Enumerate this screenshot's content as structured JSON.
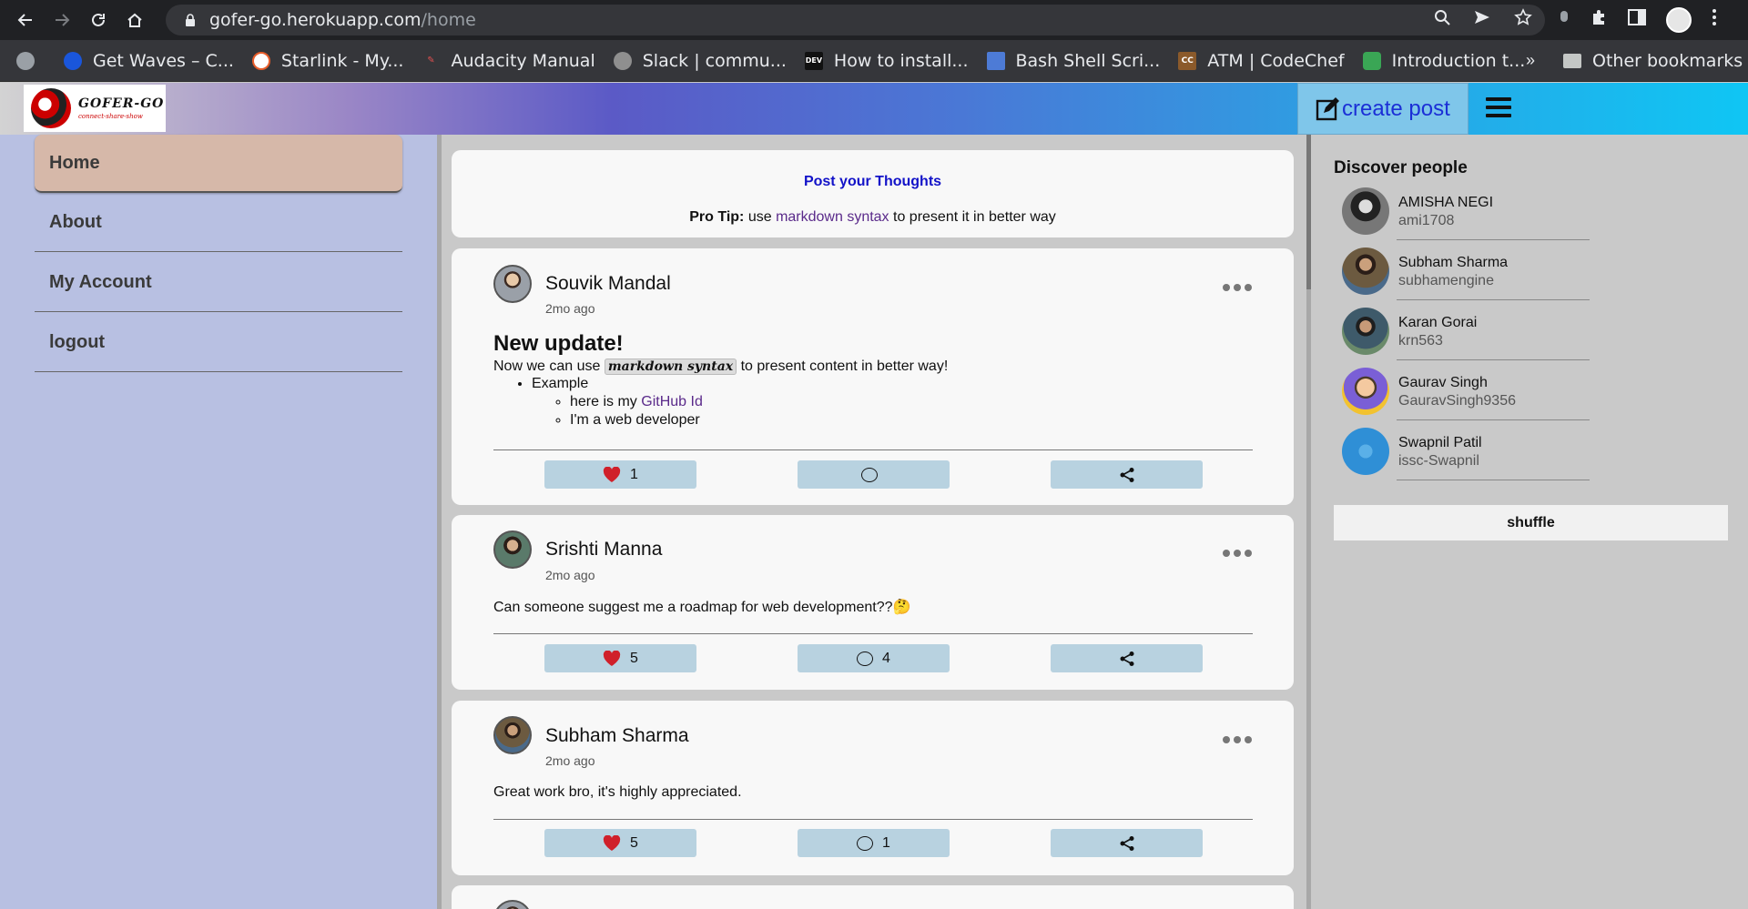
{
  "browser": {
    "url_host": "gofer-go.herokuapp.com",
    "url_path": "/home",
    "bookmarks": [
      {
        "label": "Get Waves – C...",
        "color": "#1a56db"
      },
      {
        "label": "Starlink - My...",
        "color": "#e85d2a"
      },
      {
        "label": "Audacity Manual",
        "color": "#c0392b"
      },
      {
        "label": "Slack | commu...",
        "color": "#8f8f8f"
      },
      {
        "label": "How to install...",
        "color": "#111111"
      },
      {
        "label": "Bash Shell Scri...",
        "color": "#4d7bd6"
      },
      {
        "label": "ATM | CodeChef",
        "color": "#8b5a2b"
      },
      {
        "label": "Introduction t...",
        "color": "#3aa655"
      }
    ],
    "bookmark_icons": [
      "globe",
      "circle",
      "pencil",
      "globe",
      "DEV",
      "stripes",
      "CC",
      "hexagon"
    ],
    "more": "»",
    "other_bookmarks": "Other bookmarks"
  },
  "header": {
    "logo_title": "GOFER-GO",
    "logo_tag": "connect-share-show",
    "create_post": "create post"
  },
  "sidebar": {
    "items": [
      {
        "label": "Home",
        "active": true
      },
      {
        "label": "About"
      },
      {
        "label": "My Account"
      },
      {
        "label": "logout"
      }
    ]
  },
  "prompt": {
    "title": "Post your Thoughts",
    "tip_bold": "Pro Tip:",
    "tip_pre": " use ",
    "tip_link": "markdown syntax",
    "tip_post": " to present it in better way"
  },
  "posts": [
    {
      "author": "Souvik Mandal",
      "time": "2mo ago",
      "heading": "New update!",
      "line_pre": "Now we can use ",
      "line_code": "markdown syntax",
      "line_post": " to present content in better way!",
      "list_item": "Example",
      "sub_item1_pre": "here is my ",
      "sub_item1_link": "GitHub Id",
      "sub_item2": "I'm a web developer",
      "likes": "1",
      "comments": ""
    },
    {
      "author": "Srishti Manna",
      "time": "2mo ago",
      "text": "Can someone suggest me a roadmap for web development??🤔",
      "likes": "5",
      "comments": "4"
    },
    {
      "author": "Subham Sharma",
      "time": "2mo ago",
      "text": "Great work bro, it's highly appreciated.",
      "likes": "5",
      "comments": "1"
    }
  ],
  "discover": {
    "title": "Discover people",
    "people": [
      {
        "name": "AMISHA NEGI",
        "username": "ami1708",
        "color": "#4a4a4a"
      },
      {
        "name": "Subham Sharma",
        "username": "subhamengine",
        "color": "#6a5a3e"
      },
      {
        "name": "Karan Gorai",
        "username": "krn563",
        "color": "#3e5a6a"
      },
      {
        "name": "Gaurav Singh",
        "username": "GauravSingh9356",
        "color": "#f2c230"
      },
      {
        "name": "Swapnil Patil",
        "username": "issc-Swapnil",
        "color": "#2f8fd6"
      }
    ],
    "shuffle": "shuffle"
  },
  "colors": {
    "accent_blue": "#1212c8",
    "link_purple": "#5a2a8a",
    "active_nav": "#d6b8a9",
    "sidebar_bg": "#b8c0e2",
    "action_bg": "#b8d2e0",
    "heart": "#d0202a"
  }
}
